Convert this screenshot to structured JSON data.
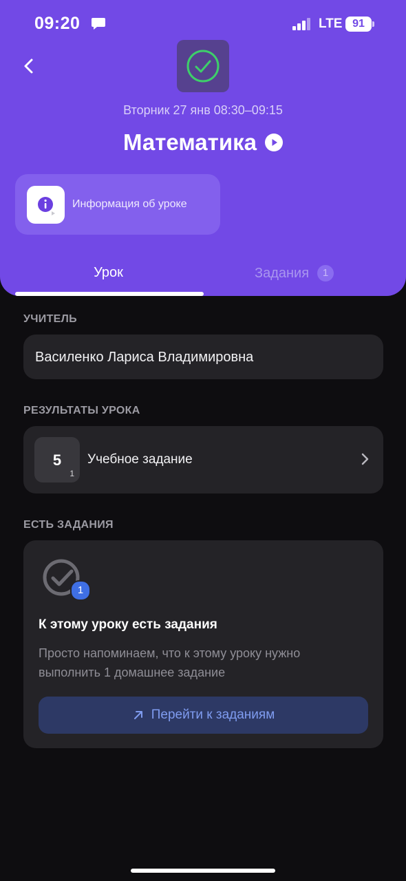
{
  "status_bar": {
    "time": "09:20",
    "network": "LTE",
    "battery": "91"
  },
  "header": {
    "datetime": "Вторник 27 янв  08:30–09:15",
    "subject": "Математика",
    "info_label": "Информация об уроке",
    "colors": {
      "header_bg": "#7249e6",
      "check": "#3ecf6a"
    }
  },
  "tabs": [
    {
      "label": "Урок",
      "active": true
    },
    {
      "label": "Задания",
      "count": "1",
      "active": false
    }
  ],
  "teacher": {
    "heading": "УЧИТЕЛЬ",
    "name": "Василенко Лариса Владимировна"
  },
  "results": {
    "heading": "РЕЗУЛЬТАТЫ УРОКА",
    "items": [
      {
        "grade": "5",
        "weight": "1",
        "label": "Учебное задание"
      }
    ]
  },
  "tasks": {
    "heading": "ЕСТЬ ЗАДАНИЯ",
    "badge": "1",
    "title": "К этому уроку есть задания",
    "description": "Просто напоминаем, что к этому уроку нужно выполнить 1 домашнее задание",
    "button": "Перейти к заданиям"
  }
}
